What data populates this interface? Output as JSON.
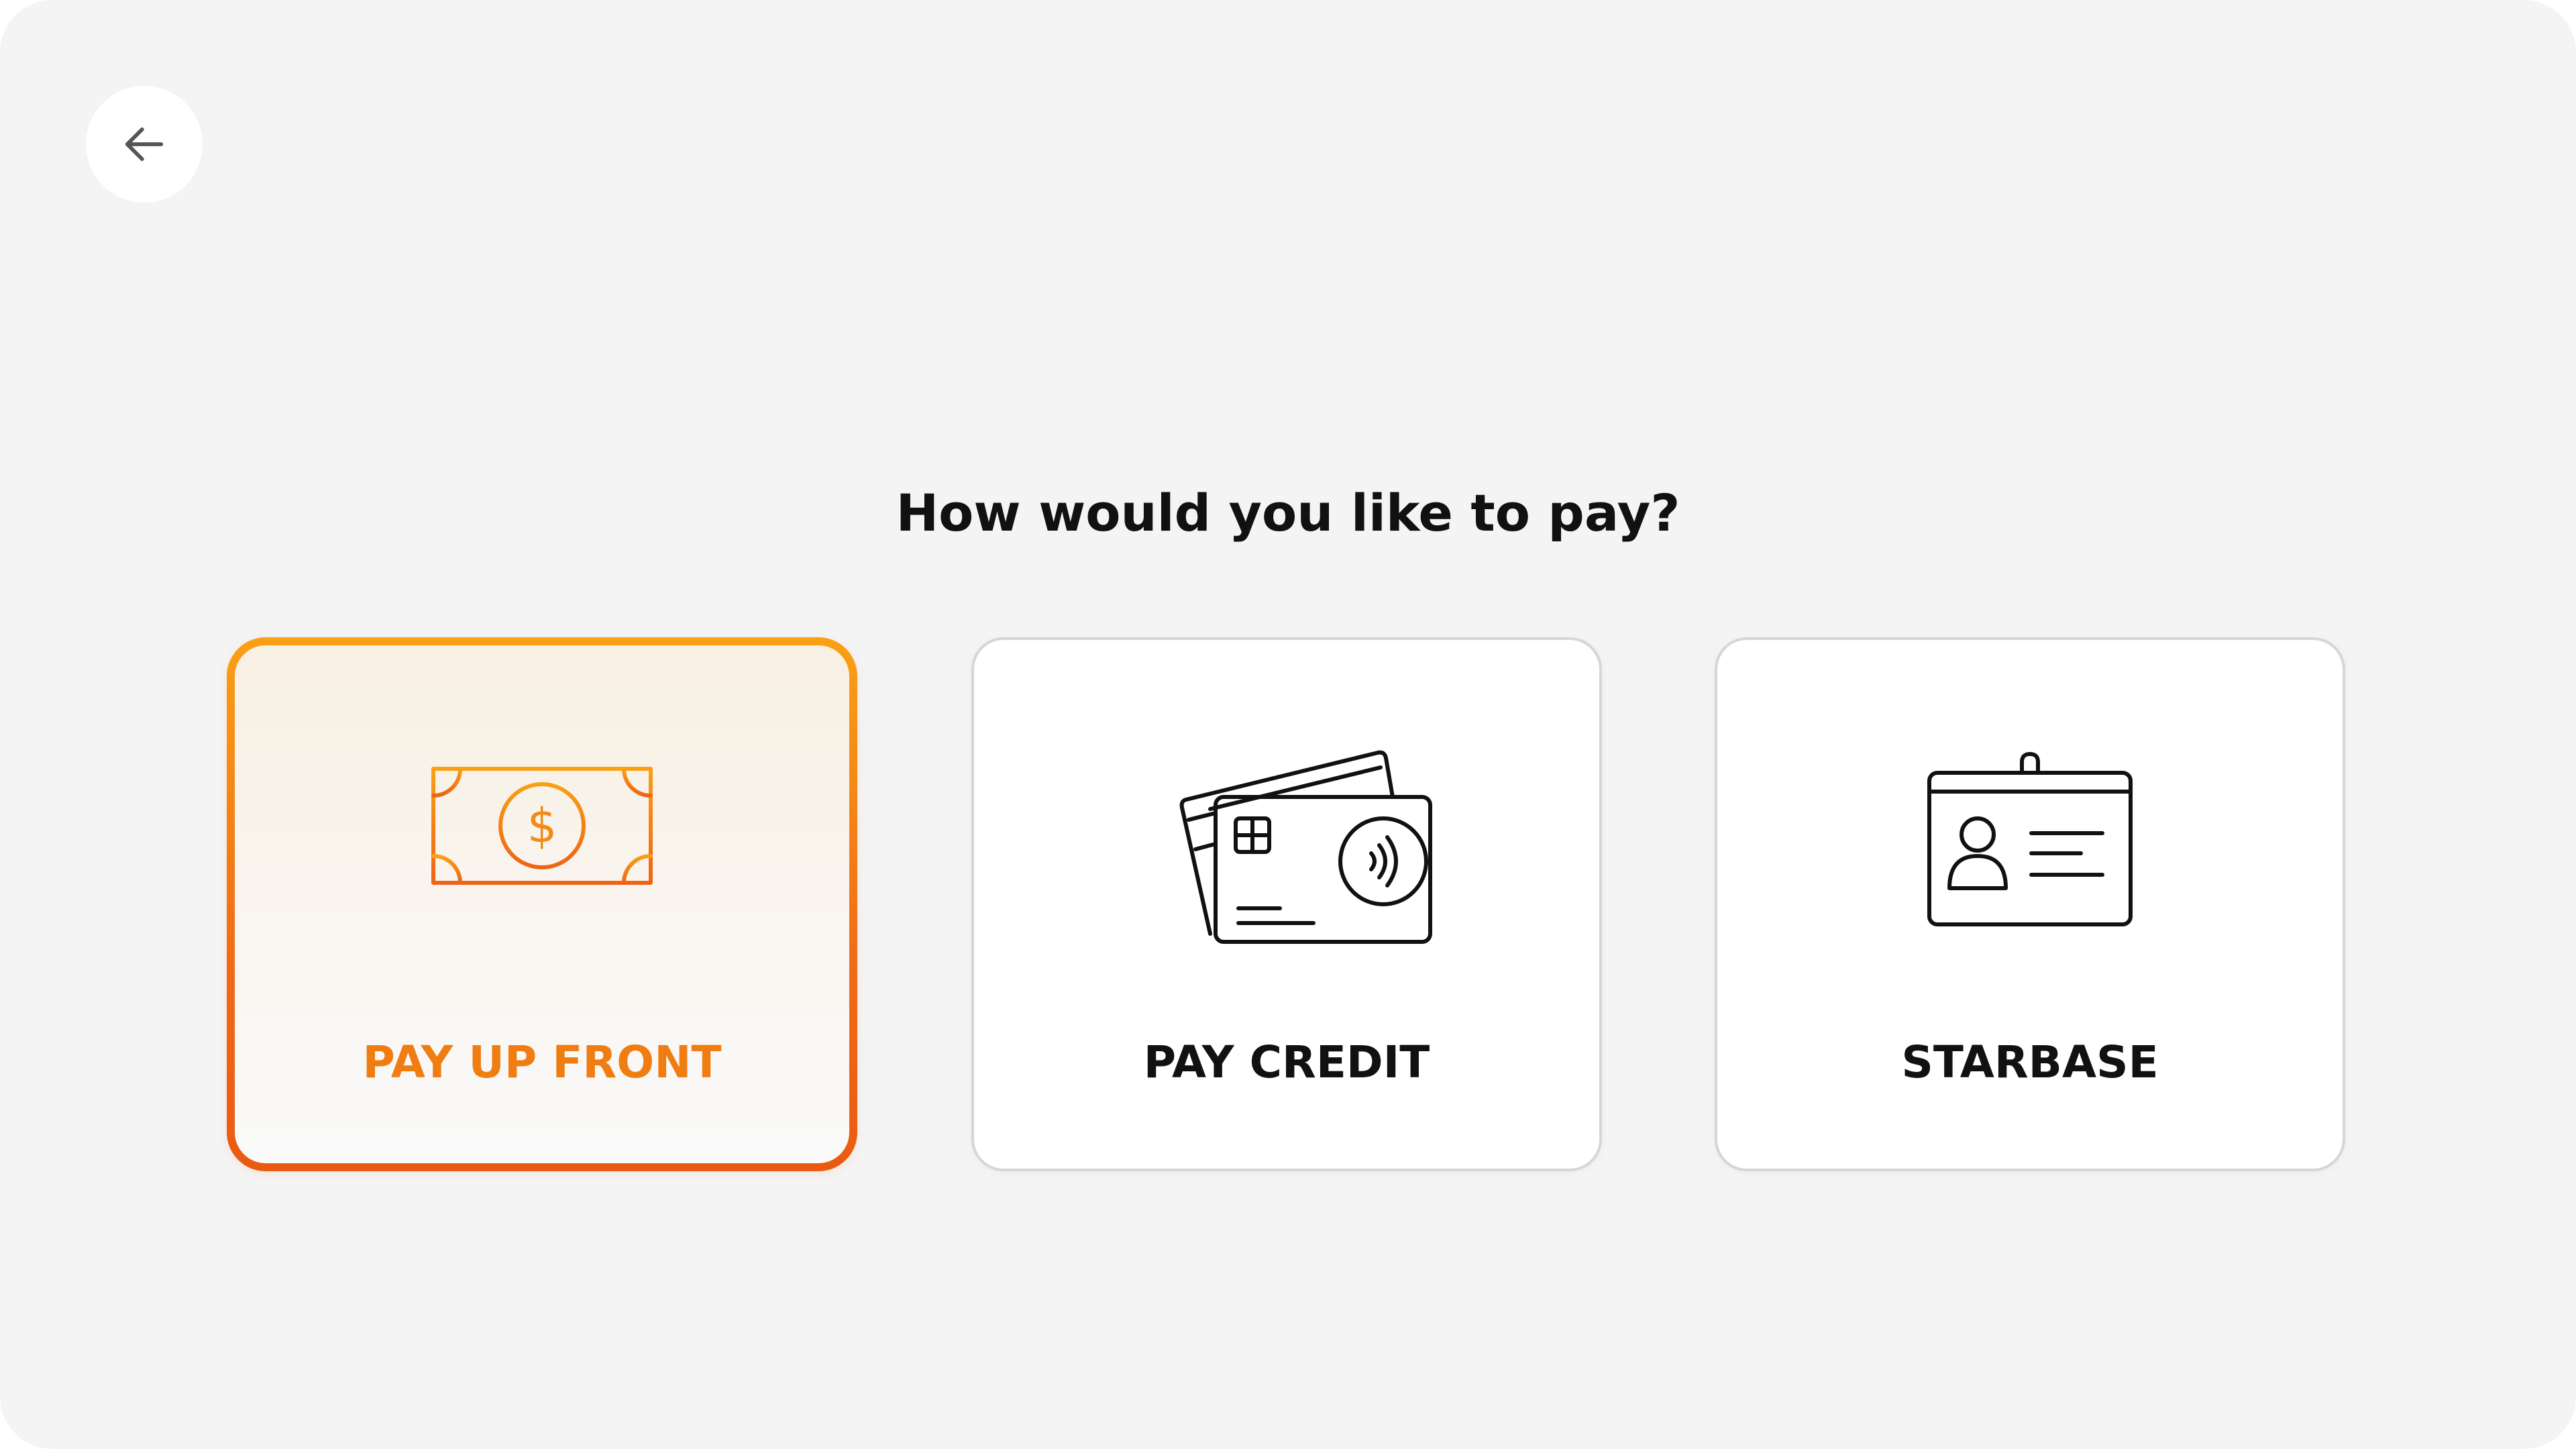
{
  "header": {
    "back_icon": "arrow-left-icon"
  },
  "prompt": {
    "title": "How would you like to pay?"
  },
  "payment_options": [
    {
      "label": "PAY UP FRONT",
      "icon": "cash-stack-icon",
      "selected": true,
      "accent_color": "#f07d12"
    },
    {
      "label": "PAY CREDIT",
      "icon": "credit-cards-icon",
      "selected": false
    },
    {
      "label": "STARBASE",
      "icon": "id-badge-icon",
      "selected": false
    }
  ],
  "colors": {
    "background": "#f4f4f4",
    "card": "#ffffff",
    "accent_start": "#f9a015",
    "accent_end": "#ea5a12",
    "text": "#111111"
  }
}
